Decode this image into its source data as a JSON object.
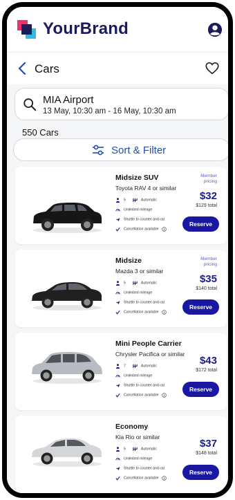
{
  "brand": {
    "name": "YourBrand",
    "colors": {
      "primary": "#1a1c5c",
      "pink": "#e8336c",
      "cyan": "#37b7e6",
      "button": "#1a17a0",
      "link": "#1f4db0"
    }
  },
  "nav": {
    "title": "Cars",
    "back_icon": "chevron-left-icon",
    "favorite_icon": "heart-icon",
    "account_icon": "account-circle-icon"
  },
  "search": {
    "location": "MIA Airport",
    "dates": "13 May, 10:30 am - 16 May, 10:30 am"
  },
  "results": {
    "count_label": "550 Cars"
  },
  "sort_filter": {
    "label": "Sort & Filter"
  },
  "cars": [
    {
      "name": "Midsize SUV",
      "similar": "Toyota RAV 4 or similar",
      "member_label": "Member pricing",
      "price": "$32",
      "total": "$129 total",
      "seats": "5",
      "transmission": "Automatic",
      "mileage": "Unlimited mileage",
      "shuttle": "Shuttle to counter and car",
      "cancellation": "Cancellation available",
      "reserve_label": "Reserve"
    },
    {
      "name": "Midsize",
      "similar": "Mazda 3 or similar",
      "member_label": "Member pricing",
      "price": "$35",
      "total": "$140 total",
      "seats": "5",
      "transmission": "Automatic",
      "mileage": "Unlimited mileage",
      "shuttle": "Shuttle to counter and car",
      "cancellation": "Cancellation available",
      "reserve_label": "Reserve"
    },
    {
      "name": "Mini People Carrier",
      "similar": "Chrysler Pacifica or similar",
      "member_label": "",
      "price": "$43",
      "total": "$172 total",
      "seats": "7",
      "transmission": "Automatic",
      "mileage": "Unlimited mileage",
      "shuttle": "Shuttle to counter and car",
      "cancellation": "Cancellation available",
      "reserve_label": "Reserve"
    },
    {
      "name": "Economy",
      "similar": "Kia Rio or similar",
      "member_label": "",
      "price": "$37",
      "total": "$148 total",
      "seats": "5",
      "transmission": "Automatic",
      "mileage": "Unlimited mileage",
      "shuttle": "Shuttle to counter and car",
      "cancellation": "Cancellation available",
      "reserve_label": "Reserve"
    }
  ]
}
